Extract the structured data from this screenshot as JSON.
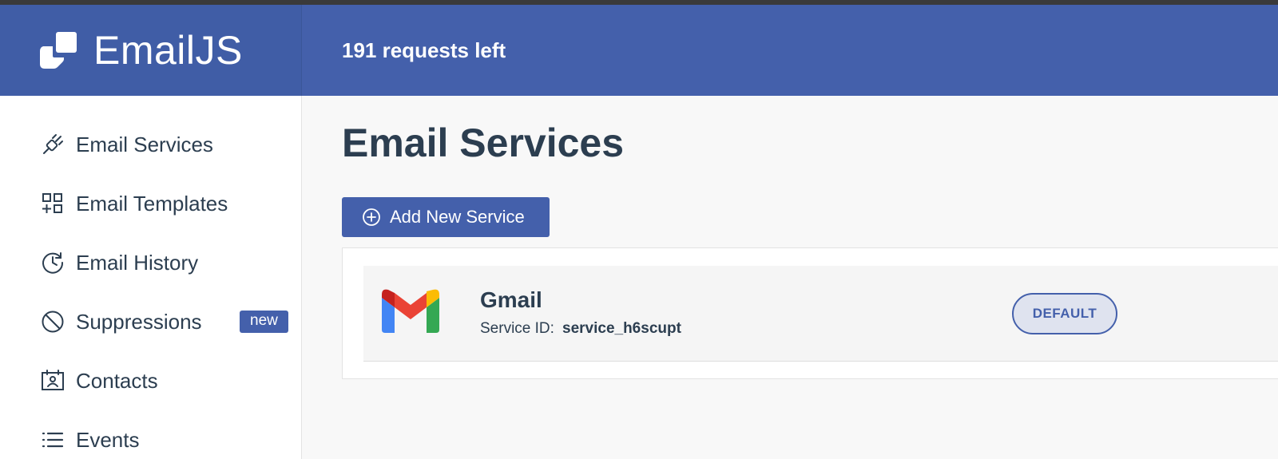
{
  "app": {
    "name": "EmailJS",
    "requests_left": "191 requests left",
    "colors": {
      "brand": "#4460ab",
      "brand_dark": "#405da6",
      "text": "#2c3e50"
    }
  },
  "sidebar": {
    "items": [
      {
        "label": "Email Services",
        "icon": "plug-icon"
      },
      {
        "label": "Email Templates",
        "icon": "template-grid-icon"
      },
      {
        "label": "Email History",
        "icon": "history-icon"
      },
      {
        "label": "Suppressions",
        "icon": "ban-icon",
        "badge": "new"
      },
      {
        "label": "Contacts",
        "icon": "contact-card-icon"
      },
      {
        "label": "Events",
        "icon": "list-icon"
      }
    ]
  },
  "main": {
    "title": "Email Services",
    "add_button_label": "Add New Service",
    "services": [
      {
        "name": "Gmail",
        "icon": "gmail-icon",
        "service_id_label": "Service ID:",
        "service_id": "service_h6scupt",
        "badge": "DEFAULT"
      }
    ]
  }
}
